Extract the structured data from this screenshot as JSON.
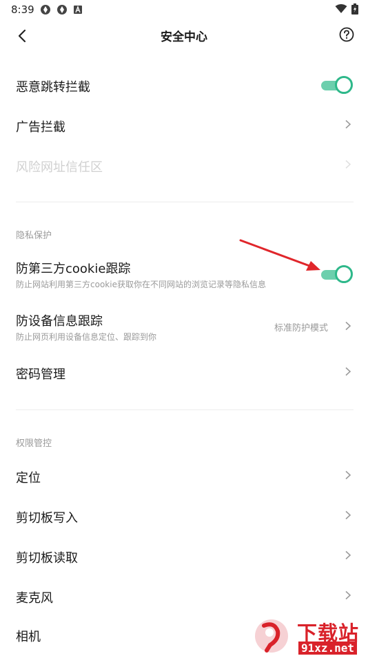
{
  "status_bar": {
    "time": "8:39"
  },
  "header": {
    "title": "安全中心"
  },
  "rows": {
    "malicious_redirect": {
      "label": "恶意跳转拦截",
      "enabled": true
    },
    "ad_block": {
      "label": "广告拦截"
    },
    "risk_url_trust": {
      "label": "风险网址信任区"
    }
  },
  "privacy": {
    "section_title": "隐私保护",
    "third_party_cookie": {
      "label": "防第三方cookie跟踪",
      "description": "防止网站利用第三方cookie获取你在不同网站的浏览记录等隐私信息",
      "enabled": true
    },
    "device_tracking": {
      "label": "防设备信息跟踪",
      "description": "防止网页利用设备信息定位、跟踪到你",
      "value": "标准防护模式"
    },
    "password": {
      "label": "密码管理"
    }
  },
  "permissions": {
    "section_title": "权限管控",
    "items": [
      {
        "label": "定位"
      },
      {
        "label": "剪切板写入"
      },
      {
        "label": "剪切板读取"
      },
      {
        "label": "麦克风"
      },
      {
        "label": "相机"
      }
    ]
  },
  "watermark": {
    "text": "下载站",
    "url_text": "91xz.net"
  },
  "colors": {
    "toggle_accent": "#2eb88a",
    "annotation_arrow": "#e0262b"
  }
}
